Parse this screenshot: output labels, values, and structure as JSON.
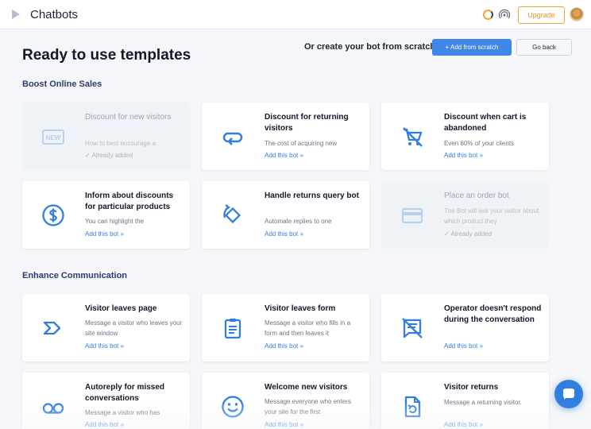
{
  "app": {
    "title": "Chatbots",
    "upgrade_label": "Upgrade"
  },
  "header": {
    "title": "Ready to use templates",
    "scratch_label": "Or create your bot from scratch",
    "add_from_scratch_label": "+ Add from scratch",
    "go_back_label": "Go back"
  },
  "colors": {
    "accent": "#2f7ee0",
    "upgrade": "#f0a43a",
    "section_title": "#2b3c73"
  },
  "sections": [
    {
      "title": "Boost Online Sales",
      "cards": [
        {
          "title": "Discount for new visitors",
          "description": "How to best encourage a",
          "status": "✓ Already added",
          "icon": "new-badge-icon",
          "disabled": true
        },
        {
          "title": "Discount for returning visitors",
          "description": "The cost of acquiring new",
          "link": "Add this bot »",
          "icon": "return-arrow-icon"
        },
        {
          "title": "Discount when cart is abandoned",
          "description": "Even 60% of your clients",
          "link": "Add this bot »",
          "icon": "cart-off-icon"
        },
        {
          "title": "Inform about discounts for particular products",
          "description": "You can highlight the",
          "link": "Add this bot »",
          "icon": "dollar-coin-icon"
        },
        {
          "title": "Handle returns query bot",
          "description": "Automate replies to one",
          "link": "Add this bot »",
          "icon": "rotate-arrow-icon"
        },
        {
          "title": "Place an order bot",
          "description": "The Bot will ask your visitor about which product they",
          "status": "✓ Already added",
          "icon": "credit-card-icon",
          "disabled": true
        }
      ]
    },
    {
      "title": "Enhance Communication",
      "cards": [
        {
          "title": "Visitor leaves page",
          "description": "Message a visitor who leaves your site window",
          "link": "Add this bot »",
          "icon": "chevron-exit-icon"
        },
        {
          "title": "Visitor leaves form",
          "description": "Message a visitor who fills in a form and then leaves it",
          "link": "Add this bot »",
          "icon": "clipboard-icon"
        },
        {
          "title": "Operator doesn't respond during the conversation",
          "description": "",
          "link": "Add this bot »",
          "icon": "chat-off-icon"
        },
        {
          "title": "Autoreply for missed conversations",
          "description": "Message a visitor who has",
          "link": "Add this bot »",
          "icon": "voicemail-icon"
        },
        {
          "title": "Welcome new visitors",
          "description": "Message everyone who enters your site for the first",
          "link": "Add this bot »",
          "icon": "smiley-icon"
        },
        {
          "title": "Visitor returns",
          "description": "Message a returning visitor.",
          "link": "Add this bot »",
          "icon": "file-return-icon"
        }
      ]
    }
  ]
}
